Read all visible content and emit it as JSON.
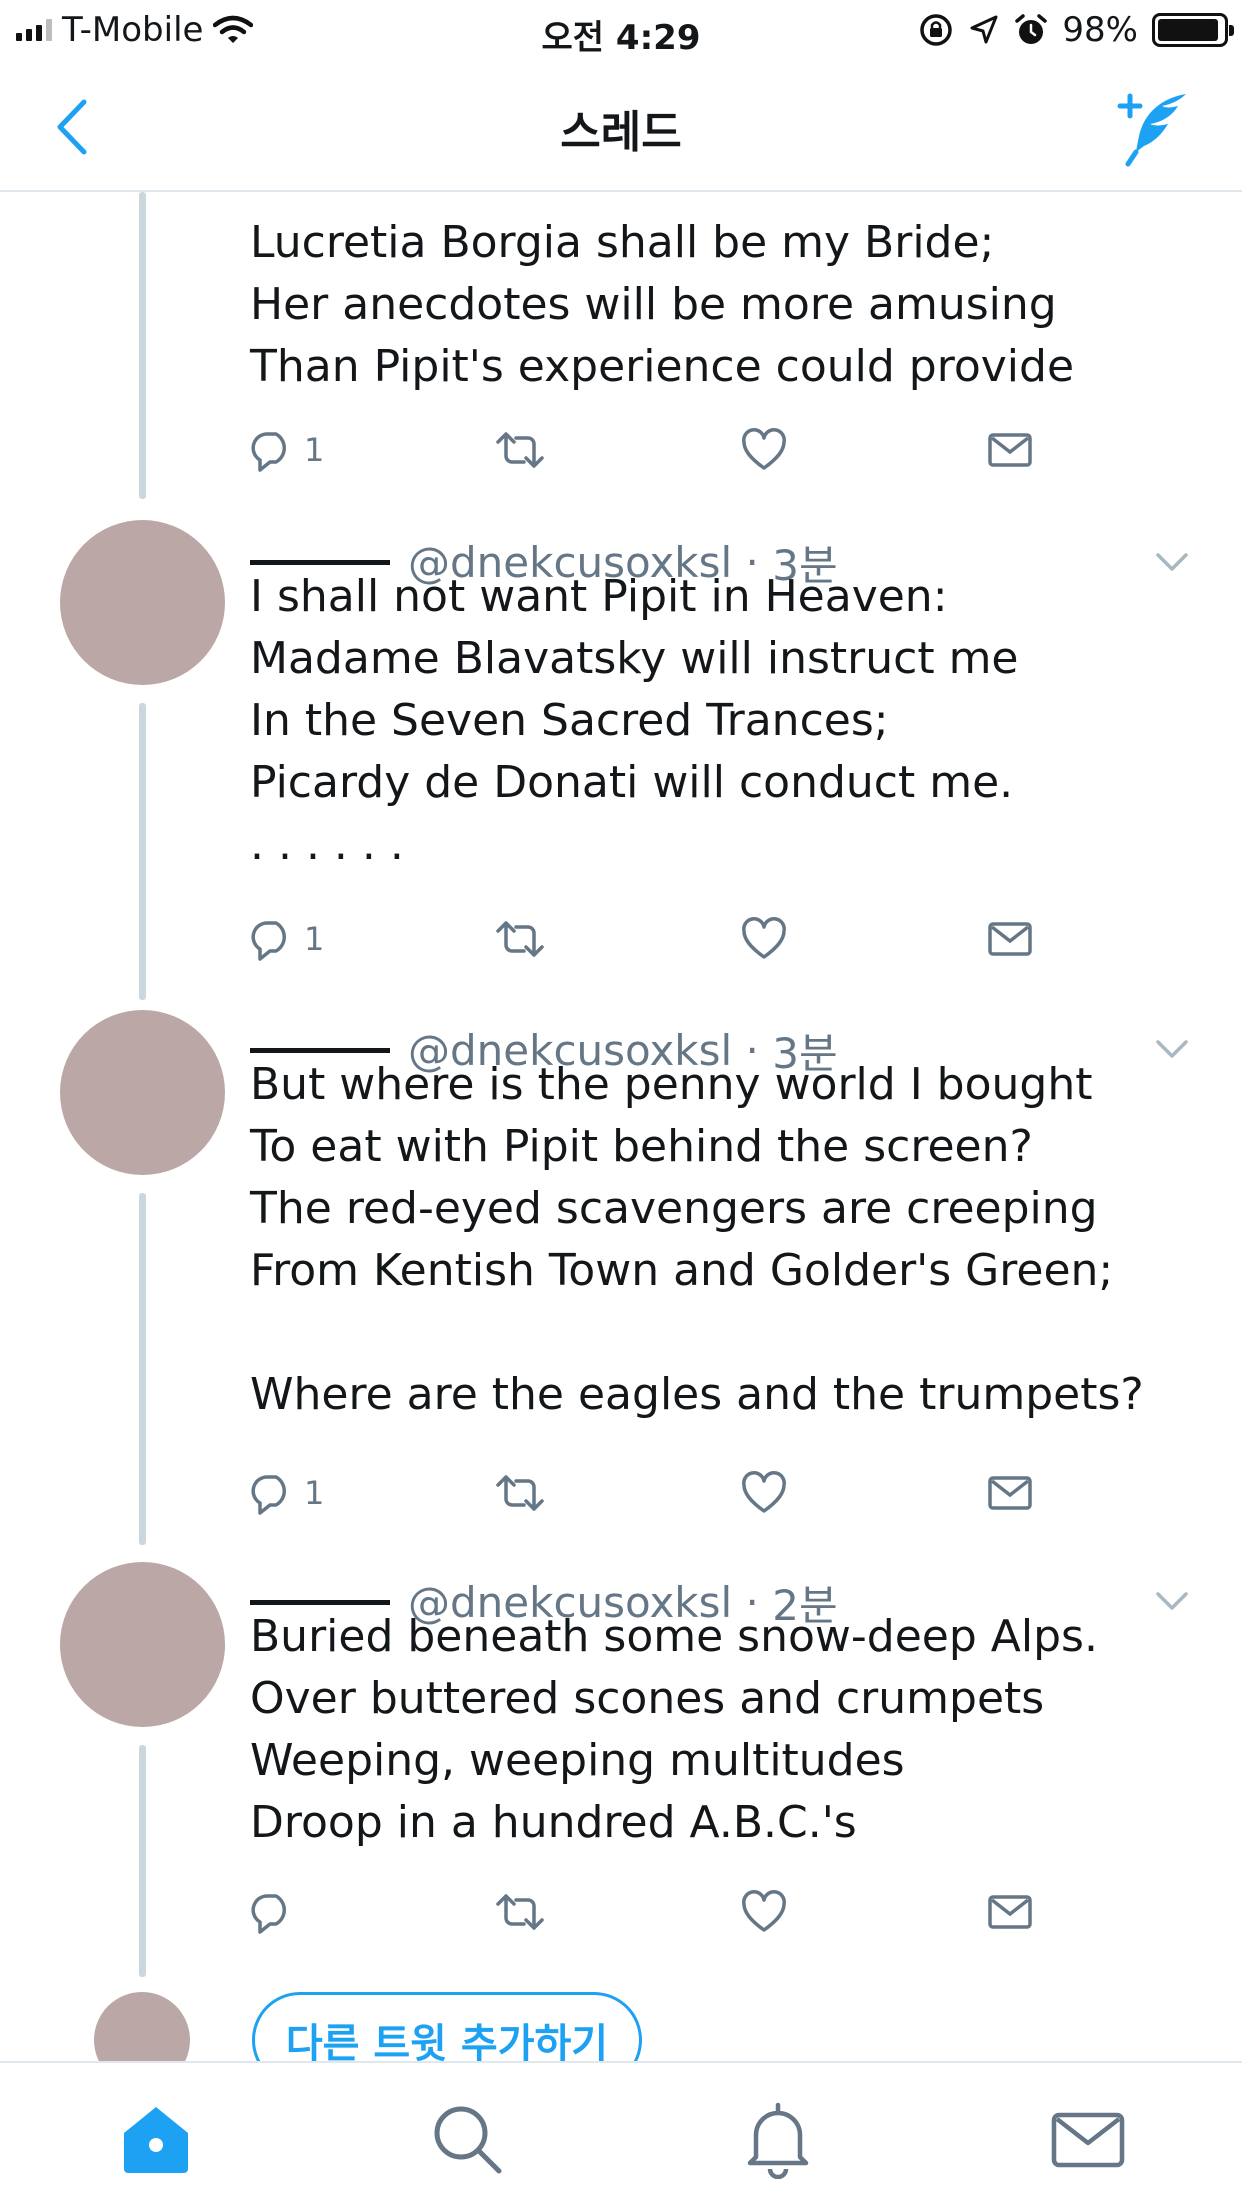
{
  "status_bar": {
    "carrier": "T-Mobile",
    "time": "오전 4:29",
    "battery": "98%"
  },
  "nav": {
    "title": "스레드",
    "back_icon": "chevron-left-icon",
    "compose_icon": "compose-tweet-icon"
  },
  "tweets": [
    {
      "handle": "",
      "time": "",
      "text": "Lucretia Borgia shall be my Bride;\nHer anecdotes will be more amusing\nThan Pipit's experience could provide",
      "reply_count": "1"
    },
    {
      "handle": "@dnekcusoxksl",
      "time": "3분",
      "text": "I shall not want Pipit in Heaven:\nMadame Blavatsky will instruct me\nIn the Seven Sacred Trances;\nPicardy de Donati will conduct me.\n. . . . . .",
      "reply_count": "1"
    },
    {
      "handle": "@dnekcusoxksl",
      "time": "3분",
      "text": "But where is the penny world I bought\nTo eat with Pipit behind the screen?\nThe red-eyed scavengers are creeping\nFrom Kentish Town and Golder's Green;\n\nWhere are the eagles and the trumpets?",
      "reply_count": "1"
    },
    {
      "handle": "@dnekcusoxksl",
      "time": "2분",
      "text": "Buried beneath some snow-deep Alps.\nOver buttered scones and crumpets\nWeeping, weeping multitudes\nDroop in a hundred A.B.C.'s",
      "reply_count": ""
    }
  ],
  "add_tweet_button": "다른 트윗 추가하기",
  "tabs": [
    "home-icon",
    "search-icon",
    "notifications-icon",
    "messages-icon"
  ],
  "colors": {
    "accent": "#1da1f2",
    "avatar": "#bba7a6",
    "thread_line": "#ccd6dd",
    "secondary_text": "#657786"
  }
}
